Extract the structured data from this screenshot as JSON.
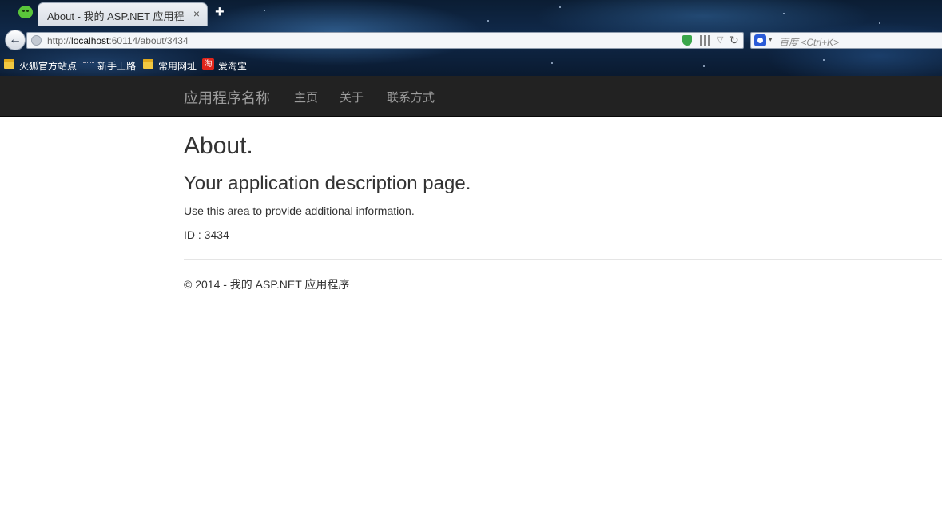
{
  "browser": {
    "tab": {
      "title": "About - 我的 ASP.NET 应用程...",
      "close": "×"
    },
    "new_tab": "+",
    "back": "←",
    "url": {
      "scheme": "http://",
      "host": "localhost",
      "rest": ":60114/about/3434"
    },
    "reload": "↻",
    "dropdown": "▽",
    "search": {
      "engine_dropdown": "▾",
      "placeholder": "百度 <Ctrl+K>"
    },
    "bookmarks": [
      {
        "label": "火狐官方站点",
        "icon": "folder-icon"
      },
      {
        "label": "新手上路",
        "icon": "dots-icon"
      },
      {
        "label": "常用网址",
        "icon": "folder-icon"
      },
      {
        "label": "爱淘宝",
        "icon": "taobao-icon",
        "icon_text": "淘"
      }
    ]
  },
  "site": {
    "brand": "应用程序名称",
    "nav": [
      "主页",
      "关于",
      "联系方式"
    ],
    "heading": "About.",
    "subheading": "Your application description page.",
    "paragraph": "Use this area to provide additional information.",
    "id_line": "ID : 3434",
    "footer": "© 2014 - 我的 ASP.NET 应用程序"
  },
  "colors": {
    "navbar_bg": "#222222",
    "nav_text": "#9d9d9d",
    "body_text": "#333333"
  }
}
